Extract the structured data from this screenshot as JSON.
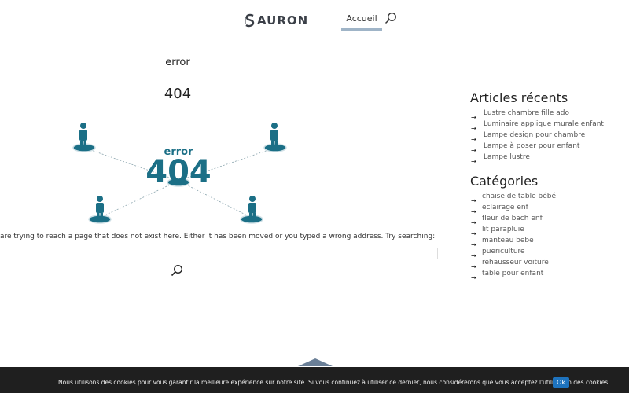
{
  "header": {
    "logo_text": "AURON",
    "nav": [
      {
        "label": "Accueil"
      }
    ],
    "search_icon": "search-icon"
  },
  "main": {
    "error_word": "error",
    "error_code": "404",
    "illustration": {
      "error_word": "error",
      "error_code": "404",
      "icon": "person-icon"
    },
    "message": "are trying to reach a page that does not exist here. Either it has been moved or you typed a wrong address. Try searching:",
    "search_input_value": "",
    "search_button_icon": "search-icon"
  },
  "sidebar": {
    "recent_title": "Articles récents",
    "recent": [
      {
        "label": "Lustre chambre fille ado"
      },
      {
        "label": "Luminaire applique murale enfant"
      },
      {
        "label": "Lampe design pour chambre"
      },
      {
        "label": "Lampe à poser pour enfant"
      },
      {
        "label": "Lampe lustre"
      }
    ],
    "categories_title": "Catégories",
    "categories": [
      {
        "label": "chaise de table bébé"
      },
      {
        "label": "eclairage enf"
      },
      {
        "label": "fleur de bach enf"
      },
      {
        "label": "lit parapluie"
      },
      {
        "label": "manteau bebe"
      },
      {
        "label": "puericulture"
      },
      {
        "label": "rehausseur voiture"
      },
      {
        "label": "table pour enfant"
      }
    ],
    "arrow_icon": "arrow-right-icon"
  },
  "cookie": {
    "text": "Nous utilisons des cookies pour vous garantir la meilleure expérience sur notre site. Si vous continuez à utiliser ce dernier, nous considérerons que vous acceptez l'utilisation des cookies.",
    "ok_label": "Ok"
  },
  "colors": {
    "accent": "#1e73be",
    "illustration": "#1b6f86",
    "cookie_bg": "#1f1f1f",
    "nav_underline": "#9fb4c7"
  }
}
